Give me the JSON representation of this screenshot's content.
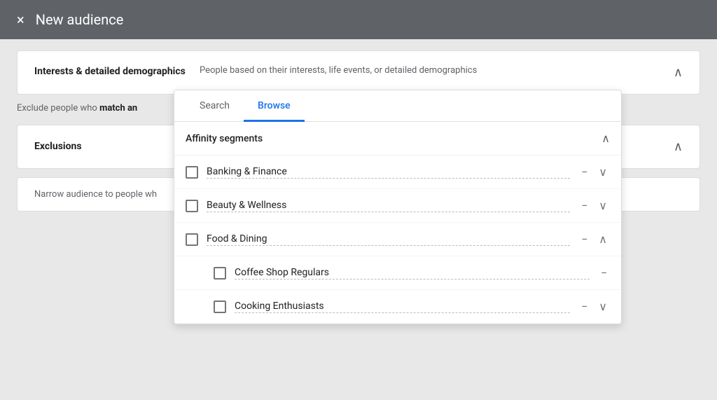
{
  "header": {
    "close_label": "×",
    "title": "New audience"
  },
  "interests_section": {
    "label": "Interests & detailed demographics",
    "description": "People based on their interests, life events, or detailed demographics",
    "chevron": "∧"
  },
  "tabs": [
    {
      "id": "search",
      "label": "Search",
      "active": false
    },
    {
      "id": "browse",
      "label": "Browse",
      "active": true
    }
  ],
  "affinity": {
    "header": "Affinity segments",
    "chevron_up": "∧",
    "items": [
      {
        "id": "banking",
        "label": "Banking & Finance",
        "expanded": false,
        "actions": [
          "−",
          "∨"
        ]
      },
      {
        "id": "beauty",
        "label": "Beauty & Wellness",
        "expanded": false,
        "actions": [
          "−",
          "∨"
        ]
      },
      {
        "id": "food",
        "label": "Food & Dining",
        "expanded": true,
        "actions": [
          "−",
          "∧"
        ],
        "children": [
          {
            "id": "coffee",
            "label": "Coffee Shop Regulars",
            "actions": [
              "−"
            ]
          },
          {
            "id": "cooking",
            "label": "Cooking Enthusiasts",
            "actions": [
              "−",
              "∨"
            ]
          }
        ]
      }
    ]
  },
  "exclusions": {
    "label": "Exclusions",
    "chevron": "∧"
  },
  "exclude_text": "Exclude people who",
  "exclude_bold": "match an",
  "narrow_text": "Narrow audience to people wh"
}
